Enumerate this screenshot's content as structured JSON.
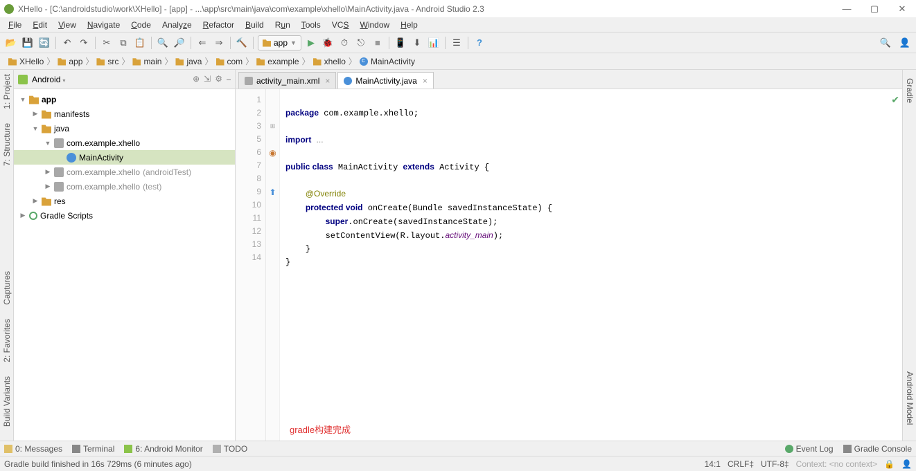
{
  "title": "XHello - [C:\\androidstudio\\work\\XHello] - [app] - ...\\app\\src\\main\\java\\com\\example\\xhello\\MainActivity.java - Android Studio 2.3",
  "menu": [
    "File",
    "Edit",
    "View",
    "Navigate",
    "Code",
    "Analyze",
    "Refactor",
    "Build",
    "Run",
    "Tools",
    "VCS",
    "Window",
    "Help"
  ],
  "run_config": "app",
  "breadcrumb": [
    {
      "icon": "folder",
      "label": "XHello"
    },
    {
      "icon": "folder",
      "label": "app"
    },
    {
      "icon": "folder",
      "label": "src"
    },
    {
      "icon": "folder",
      "label": "main"
    },
    {
      "icon": "folder",
      "label": "java"
    },
    {
      "icon": "folder",
      "label": "com"
    },
    {
      "icon": "folder",
      "label": "example"
    },
    {
      "icon": "folder",
      "label": "xhello"
    },
    {
      "icon": "class",
      "label": "MainActivity"
    }
  ],
  "left_tools": [
    "1: Project",
    "7: Structure",
    "Captures",
    "2: Favorites",
    "Build Variants"
  ],
  "right_tools": [
    "Gradle",
    "Android Model"
  ],
  "project_header": "Android",
  "tree": [
    {
      "d": 0,
      "tw": "▼",
      "ic": "fld",
      "label": "app",
      "bold": true
    },
    {
      "d": 1,
      "tw": "▶",
      "ic": "fld",
      "label": "manifests"
    },
    {
      "d": 1,
      "tw": "▼",
      "ic": "fld",
      "label": "java"
    },
    {
      "d": 2,
      "tw": "▼",
      "ic": "pkg",
      "label": "com.example.xhello"
    },
    {
      "d": 3,
      "tw": "",
      "ic": "cls",
      "label": "MainActivity",
      "sel": true
    },
    {
      "d": 2,
      "tw": "▶",
      "ic": "pkg",
      "label": "com.example.xhello",
      "suffix": "(androidTest)",
      "dim": true
    },
    {
      "d": 2,
      "tw": "▶",
      "ic": "pkg",
      "label": "com.example.xhello",
      "suffix": "(test)",
      "dim": true
    },
    {
      "d": 1,
      "tw": "▶",
      "ic": "fld",
      "label": "res"
    },
    {
      "d": 0,
      "tw": "▶",
      "ic": "grd",
      "label": "Gradle Scripts"
    }
  ],
  "tabs": [
    {
      "icon": "xml",
      "label": "activity_main.xml",
      "active": false
    },
    {
      "icon": "class",
      "label": "MainActivity.java",
      "active": true
    }
  ],
  "code_lines": [
    1,
    2,
    3,
    5,
    6,
    7,
    8,
    9,
    10,
    11,
    12,
    13,
    14
  ],
  "overlay": "gradle构建完成",
  "bottom_tabs_left": [
    "0: Messages",
    "Terminal",
    "6: Android Monitor",
    "TODO"
  ],
  "bottom_tabs_right": [
    "Event Log",
    "Gradle Console"
  ],
  "status_msg": "Gradle build finished in 16s 729ms (6 minutes ago)",
  "status_pos": "14:1",
  "status_sep": "CRLF‡",
  "status_enc": "UTF-8‡",
  "status_ctx": "Context: <no context>"
}
